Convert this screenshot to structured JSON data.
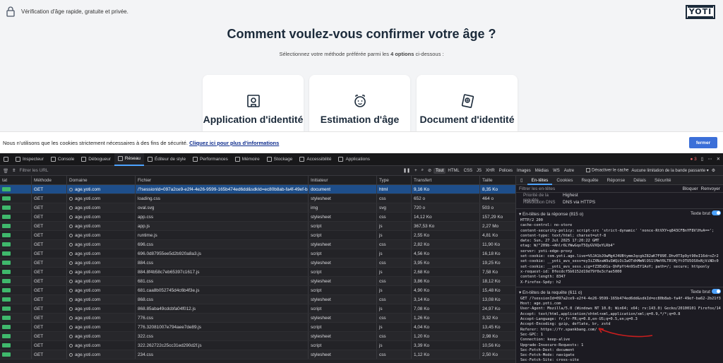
{
  "site": {
    "banner_text": "Vérification d'âge rapide, gratuite et privée.",
    "logo_text": "YOTI",
    "title": "Comment voulez-vous confirmer votre âge ?",
    "subtitle_pre": "Sélectionnez votre méthode préférée parmi les ",
    "subtitle_bold": "4 options",
    "subtitle_post": " ci-dessous :",
    "cards": [
      {
        "label": "Application d'identité",
        "icon": "id-app-icon"
      },
      {
        "label": "Estimation d'âge",
        "icon": "face-scan-icon"
      },
      {
        "label": "Document d'identité",
        "icon": "id-document-icon"
      }
    ]
  },
  "cookie": {
    "text": "Nous n'utilisons que les cookies strictement nécessaires à des fins de sécurité. ",
    "link": "Cliquez ici pour plus d'informations",
    "button": "fermer"
  },
  "devtools": {
    "tabs": [
      "Inspecteur",
      "Console",
      "Débogueur",
      "Réseau",
      "Éditeur de style",
      "Performances",
      "Mémoire",
      "Stockage",
      "Accessibilité",
      "Applications"
    ],
    "active_tab": "Réseau",
    "error_count": "3",
    "filter_placeholder": "Filtrer les URL",
    "type_filters": [
      "Tout",
      "HTML",
      "CSS",
      "JS",
      "XHR",
      "Polices",
      "Images",
      "Médias",
      "WS",
      "Autre"
    ],
    "disable_cache": "Désactiver le cache",
    "throttle": "Aucune limitation de la bande passante",
    "columns": [
      "tat",
      "Méthode",
      "Domaine",
      "Fichier",
      "Initiateur",
      "Type",
      "Transfert",
      "Taille"
    ],
    "rows": [
      {
        "method": "GET",
        "domain": "age.yoti.com",
        "file": "/?sessionId=097a2ce9-e2f4-4e26-9599-165b474ed6dd&sdkId=ec80b8ab-fa4f-49ef-ba62-2b",
        "initiator": "document",
        "type": "html",
        "transfer": "9,16 Ko",
        "size": "8,35 Ko",
        "selected": true
      },
      {
        "method": "GET",
        "domain": "age.yoti.com",
        "file": "loading.css",
        "initiator": "stylesheet",
        "type": "css",
        "transfer": "652 o",
        "size": "464 o"
      },
      {
        "method": "GET",
        "domain": "age.yoti.com",
        "file": "oval.svg",
        "initiator": "img",
        "type": "svg",
        "transfer": "720 o",
        "size": "503 o"
      },
      {
        "method": "GET",
        "domain": "age.yoti.com",
        "file": "app.css",
        "initiator": "stylesheet",
        "type": "css",
        "transfer": "14,12 Ko",
        "size": "157,29 Ko"
      },
      {
        "method": "GET",
        "domain": "age.yoti.com",
        "file": "app.js",
        "initiator": "script",
        "type": "js",
        "transfer": "367,53 Ko",
        "size": "2,27 Mo"
      },
      {
        "method": "GET",
        "domain": "age.yoti.com",
        "file": "runtime.js",
        "initiator": "script",
        "type": "js",
        "transfer": "2,55 Ko",
        "size": "4,81 Ko"
      },
      {
        "method": "GET",
        "domain": "age.yoti.com",
        "file": "696.css",
        "initiator": "stylesheet",
        "type": "css",
        "transfer": "2,82 Ko",
        "size": "11,90 Ko"
      },
      {
        "method": "GET",
        "domain": "age.yoti.com",
        "file": "696.0d87955ee5d2b920a8a3.js",
        "initiator": "script",
        "type": "js",
        "transfer": "4,56 Ko",
        "size": "16,18 Ko"
      },
      {
        "method": "GET",
        "domain": "age.yoti.com",
        "file": "884.css",
        "initiator": "stylesheet",
        "type": "css",
        "transfer": "3,95 Ko",
        "size": "19,25 Ko"
      },
      {
        "method": "GET",
        "domain": "age.yoti.com",
        "file": "884.8f4b58c7eb65397c1617.js",
        "initiator": "script",
        "type": "js",
        "transfer": "2,68 Ko",
        "size": "7,58 Ko"
      },
      {
        "method": "GET",
        "domain": "age.yoti.com",
        "file": "681.css",
        "initiator": "stylesheet",
        "type": "css",
        "transfer": "3,86 Ko",
        "size": "18,12 Ko"
      },
      {
        "method": "GET",
        "domain": "age.yoti.com",
        "file": "681.caa8b052745d4c6b4f3e.js",
        "initiator": "script",
        "type": "js",
        "transfer": "4,90 Ko",
        "size": "15,48 Ko"
      },
      {
        "method": "GET",
        "domain": "age.yoti.com",
        "file": "868.css",
        "initiator": "stylesheet",
        "type": "css",
        "transfer": "3,14 Ko",
        "size": "13,08 Ko"
      },
      {
        "method": "GET",
        "domain": "age.yoti.com",
        "file": "868.85aba49cdcbfa04f012.js",
        "initiator": "script",
        "type": "js",
        "transfer": "7,08 Ko",
        "size": "24,97 Ko"
      },
      {
        "method": "GET",
        "domain": "age.yoti.com",
        "file": "776.css",
        "initiator": "stylesheet",
        "type": "css",
        "transfer": "1,26 Ko",
        "size": "3,32 Ko"
      },
      {
        "method": "GET",
        "domain": "age.yoti.com",
        "file": "776.32081007e794aee7de89.js",
        "initiator": "script",
        "type": "js",
        "transfer": "4,04 Ko",
        "size": "13,45 Ko"
      },
      {
        "method": "GET",
        "domain": "age.yoti.com",
        "file": "322.css",
        "initiator": "stylesheet",
        "type": "css",
        "transfer": "1,20 Ko",
        "size": "2,98 Ko"
      },
      {
        "method": "GET",
        "domain": "age.yoti.com",
        "file": "322.262722c25cc31ed290d2f.js",
        "initiator": "script",
        "type": "js",
        "transfer": "3,39 Ko",
        "size": "10,56 Ko"
      },
      {
        "method": "GET",
        "domain": "age.yoti.com",
        "file": "234.css",
        "initiator": "stylesheet",
        "type": "css",
        "transfer": "1,12 Ko",
        "size": "2,50 Ko"
      }
    ],
    "detail_tabs": [
      "En-têtes",
      "Cookies",
      "Requête",
      "Réponse",
      "Délais",
      "Sécurité"
    ],
    "detail_filter_placeholder": "Filtrer les en-têtes",
    "block_btn": "Bloquer",
    "resend_btn": "Renvoyer",
    "meta": [
      {
        "k": "Priorité de la requête",
        "v": "Highest"
      },
      {
        "k": "Résolution DNS",
        "v": "DNS via HTTPS"
      }
    ],
    "resp_section": "En-têtes de la réponse (815 o)",
    "req_section": "En-têtes de la requête (611 o)",
    "raw_label": "Texte brut",
    "resp_raw": "HTTP/2 200\ncache-control: no-store\ncontent-security-policy: script-src 'strict-dynamic' 'nonce-RtVXY+q843CFBnYF8VlHvA==';\ncontent-type: text/html; charset=utf-8\ndate: Sun, 27 Jul 2025 17:20:22 GMT\netag: W/\"209b-+Ahlr6LYWwGqoT5QyGVXQeYLRb4\"\nserver: yoti-edge-proxy\nset-cookie: com.yoti.age.live=%5JA1bJOwMg4J4UBtymmJqcgkZ82aK7F89E.Dhv0T3p9yt90eI16droZr2\nset-cookie: __yoti_avs_sess=ey3iZXNzaW9uSWQiOiIwOTdhMmNlOS1lMmY0LTRlMjYtOTU5OS0xNjViNDc0\nset-cookie: __yoti_avs_sess.sig=fZ3EoD1u-QhPpYt4n9SsEf1AoY; path=/; secure; httponly\nx-request-id: 0fecdcf5b6152d19d79f0e3cfae5000\ncontent-length: 8347\nX-Firefox-Spdy: h2",
    "req_raw": "GET /?sessionId=097a2ce9-e2f4-4e26-9599-165b474ed6dd&sdkId=ec80b8ab-fa4f-49ef-ba62-2b21f3\nHost: age.yoti.com\nUser-Agent: Mozilla/5.0 (Windows NT 10.0; Win64; x64; rv:143.0) Gecko/20100101 Firefox/14\nAccept: text/html,application/xhtml+xml,application/xml;q=0.9,*/*;q=0.8\nAccept-Language: fr,fr-FR;q=0.8,en-US;q=0.5,en;q=0.3\nAccept-Encoding: gzip, deflate, br, zstd\nReferer: https://fr.spankbang.com/\nSec-GPC: 1\nConnection: keep-alive\nUpgrade-Insecure-Requests: 1\nSec-Fetch-Dest: document\nSec-Fetch-Mode: navigate\nSec-Fetch-Site: cross-site"
  }
}
